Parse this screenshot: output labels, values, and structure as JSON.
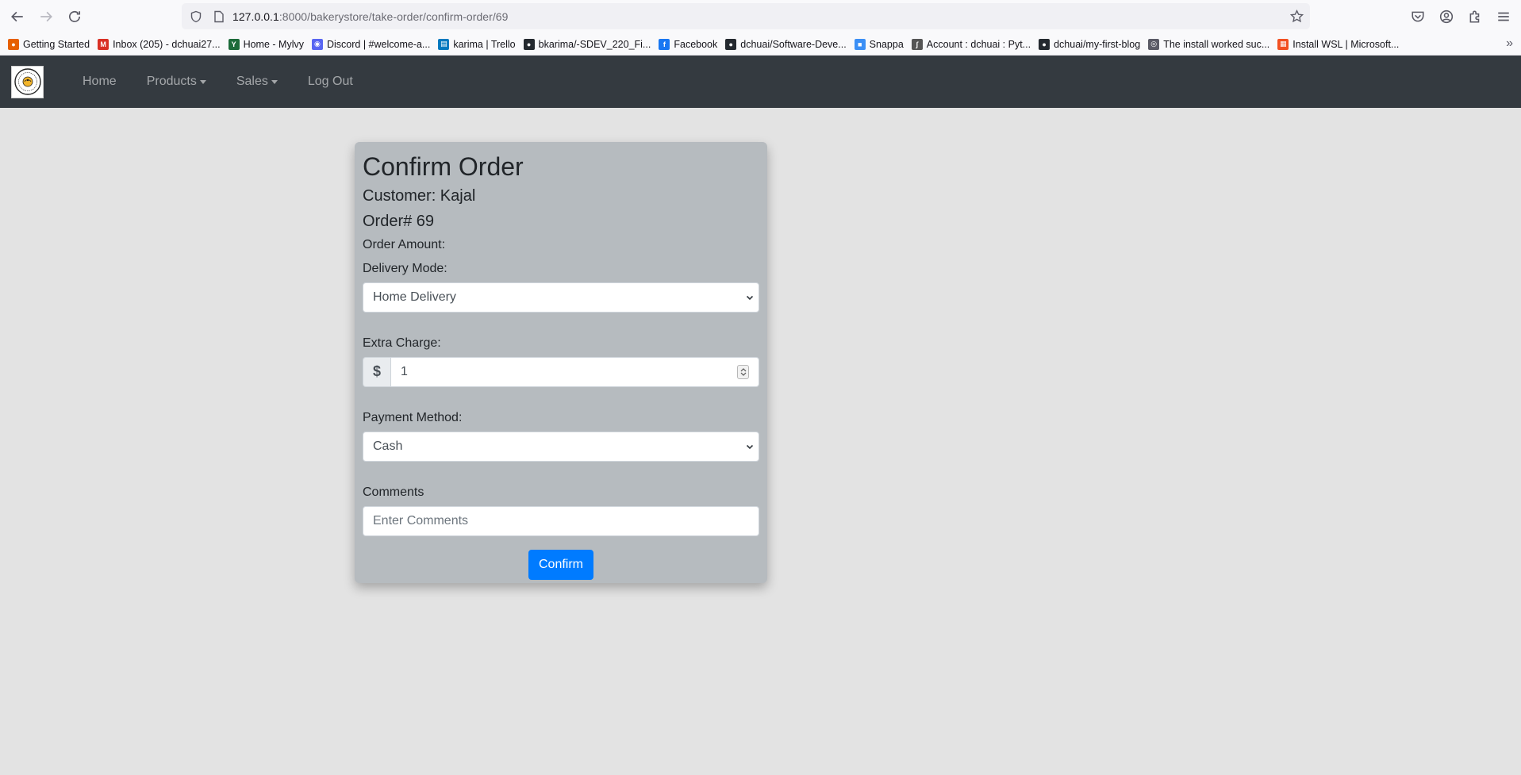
{
  "browser": {
    "url_host": "127.0.0.1",
    "url_rest": ":8000/bakerystore/take-order/confirm-order/69",
    "bookmarks": [
      {
        "label": "Getting Started",
        "icon": "firefox-icon",
        "color": "#e66000"
      },
      {
        "label": "Inbox (205) - dchuai27...",
        "icon": "gmail-icon",
        "color": "#d93025"
      },
      {
        "label": "Home - Mylvy",
        "icon": "mylvy-icon",
        "color": "#1d6b3a"
      },
      {
        "label": "Discord | #welcome-a...",
        "icon": "discord-icon",
        "color": "#5865f2"
      },
      {
        "label": "karima | Trello",
        "icon": "trello-icon",
        "color": "#0079bf"
      },
      {
        "label": "bkarima/-SDEV_220_Fi...",
        "icon": "github-icon",
        "color": "#24292f"
      },
      {
        "label": "Facebook",
        "icon": "facebook-icon",
        "color": "#1877f2"
      },
      {
        "label": "dchuai/Software-Deve...",
        "icon": "github-icon",
        "color": "#24292f"
      },
      {
        "label": "Snappa",
        "icon": "snappa-icon",
        "color": "#3b8ff5"
      },
      {
        "label": "Account : dchuai : Pyt...",
        "icon": "pythonanywhere-icon",
        "color": "#555555"
      },
      {
        "label": "dchuai/my-first-blog",
        "icon": "github-icon",
        "color": "#24292f"
      },
      {
        "label": "The install worked suc...",
        "icon": "globe-icon",
        "color": "#5b5b66"
      },
      {
        "label": "Install WSL | Microsoft...",
        "icon": "microsoft-icon",
        "color": "#f25022"
      }
    ]
  },
  "navbar": {
    "items": [
      {
        "label": "Home"
      },
      {
        "label": "Products"
      },
      {
        "label": "Sales"
      },
      {
        "label": "Log Out"
      }
    ]
  },
  "form": {
    "title": "Confirm Order",
    "customer": "Customer: Kajal",
    "order_number": "Order# 69",
    "order_amount_label": "Order Amount:",
    "delivery_mode_label": "Delivery Mode:",
    "delivery_mode_value": "Home Delivery",
    "extra_charge_label": "Extra Charge:",
    "currency_symbol": "$",
    "extra_charge_value": "1",
    "payment_method_label": "Payment Method:",
    "payment_method_value": "Cash",
    "comments_label": "Comments",
    "comments_placeholder": "Enter Comments",
    "confirm_label": "Confirm"
  },
  "colors": {
    "navbar_bg": "#343a40",
    "page_bg": "#e3e3e3",
    "card_bg": "#b6bbbf",
    "primary": "#007bff"
  }
}
